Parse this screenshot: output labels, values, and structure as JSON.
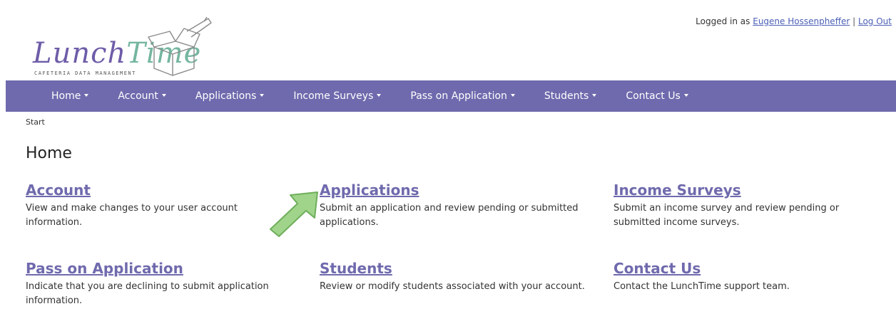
{
  "logo": {
    "word_part1": "Lunch",
    "word_part2": "Time",
    "tagline": "CAFETERIA DATA MANAGEMENT"
  },
  "user": {
    "prefix": "Logged in as",
    "name": "Eugene Hossenpheffer",
    "separator": "|",
    "logout": "Log Out"
  },
  "nav": {
    "items": [
      {
        "label": "Home"
      },
      {
        "label": "Account"
      },
      {
        "label": "Applications"
      },
      {
        "label": "Income Surveys"
      },
      {
        "label": "Pass on Application"
      },
      {
        "label": "Students"
      },
      {
        "label": "Contact Us"
      }
    ]
  },
  "breadcrumb": "Start",
  "page_title": "Home",
  "cards": [
    {
      "title": "Account",
      "desc": "View and make changes to your user account information."
    },
    {
      "title": "Applications",
      "desc": "Submit an application and review pending or submitted applications."
    },
    {
      "title": "Income Surveys",
      "desc": "Submit an income survey and review pending or submitted income surveys."
    },
    {
      "title": "Pass on Application",
      "desc": "Indicate that you are declining to submit application information."
    },
    {
      "title": "Students",
      "desc": "Review or modify students associated with your account."
    },
    {
      "title": "Contact Us",
      "desc": "Contact the LunchTime support team."
    }
  ],
  "colors": {
    "nav_bg": "#6f6aad",
    "link": "#6f6aad",
    "logo_purple": "#6e5ca8",
    "logo_teal": "#75b6a0",
    "arrow": "#8cc87a"
  }
}
